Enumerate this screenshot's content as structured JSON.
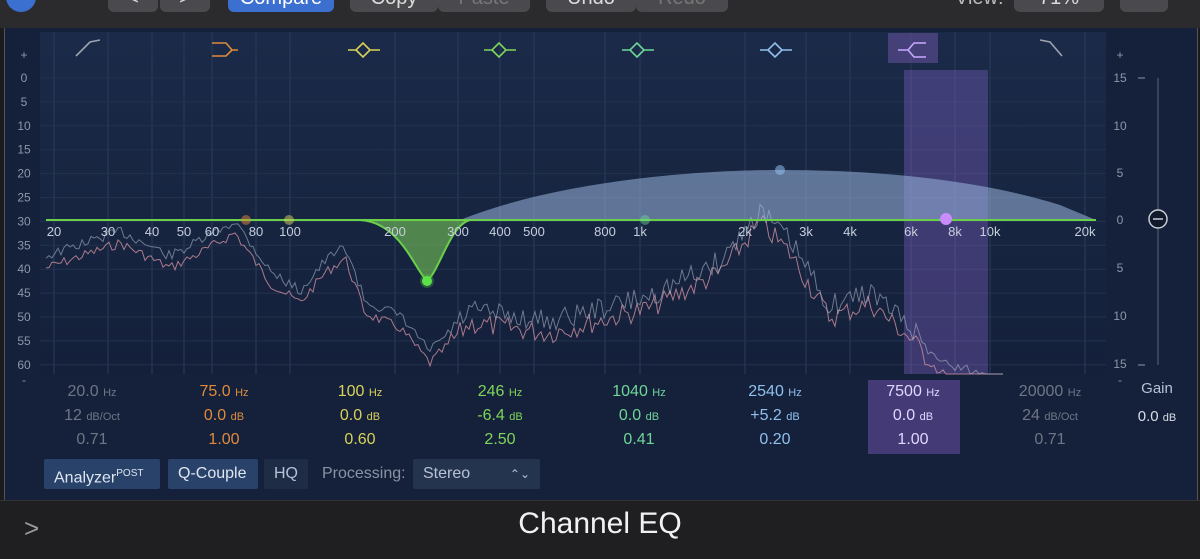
{
  "toolbar": {
    "back_label": "<",
    "forward_label": ">",
    "compare_label": "Compare",
    "copy_label": "Copy",
    "paste_label": "Paste",
    "undo_label": "Undo",
    "redo_label": "Redo",
    "view_label": "View:",
    "view_value": "71%"
  },
  "colors": {
    "band1": "#9ea3ad",
    "band2": "#e08a3c",
    "band3": "#d9d25a",
    "band4": "#7fd65a",
    "band5": "#6fd69a",
    "band6": "#8fc0ee",
    "band7": "#c8a8ff",
    "band8": "#9ea3ad",
    "curve": "#6ad04a",
    "fill": "#9ab6de"
  },
  "left_scale": [
    "+",
    "0",
    "5",
    "10",
    "15",
    "20",
    "25",
    "30",
    "35",
    "40",
    "45",
    "50",
    "55",
    "60",
    "-"
  ],
  "right_scale": [
    "+",
    "15",
    "10",
    "5",
    "0",
    "5",
    "10",
    "15",
    "-"
  ],
  "freq_labels": [
    "20",
    "30",
    "40",
    "50",
    "60",
    "80",
    "100",
    "200",
    "300",
    "400",
    "500",
    "800",
    "1k",
    "2k",
    "3k",
    "4k",
    "6k",
    "8k",
    "10k",
    "20k"
  ],
  "bands": [
    {
      "freq": "20.0",
      "freq_unit": "Hz",
      "gain": "12",
      "gain_unit": "dB/Oct",
      "q": "0.71",
      "icon": "low-cut-icon"
    },
    {
      "freq": "75.0",
      "freq_unit": "Hz",
      "gain": "0.0",
      "gain_unit": "dB",
      "q": "1.00",
      "icon": "low-shelf-icon"
    },
    {
      "freq": "100",
      "freq_unit": "Hz",
      "gain": "0.0",
      "gain_unit": "dB",
      "q": "0.60",
      "icon": "bell-icon"
    },
    {
      "freq": "246",
      "freq_unit": "Hz",
      "gain": "-6.4",
      "gain_unit": "dB",
      "q": "2.50",
      "icon": "bell-icon"
    },
    {
      "freq": "1040",
      "freq_unit": "Hz",
      "gain": "0.0",
      "gain_unit": "dB",
      "q": "0.41",
      "icon": "bell-icon"
    },
    {
      "freq": "2540",
      "freq_unit": "Hz",
      "gain": "+5.2",
      "gain_unit": "dB",
      "q": "0.20",
      "icon": "bell-icon"
    },
    {
      "freq": "7500",
      "freq_unit": "Hz",
      "gain": "0.0",
      "gain_unit": "dB",
      "q": "1.00",
      "icon": "high-shelf-icon"
    },
    {
      "freq": "20000",
      "freq_unit": "Hz",
      "gain": "24",
      "gain_unit": "dB/Oct",
      "q": "0.71",
      "icon": "high-cut-icon"
    }
  ],
  "controls": {
    "analyzer_label": "Analyzer",
    "analyzer_sup": "POST",
    "qcouple_label": "Q-Couple",
    "hq_label": "HQ",
    "processing_label": "Processing:",
    "processing_value": "Stereo"
  },
  "gain": {
    "label": "Gain",
    "value": "0.0",
    "unit": "dB"
  },
  "footer": {
    "title": "Channel EQ",
    "expand_icon": ">"
  }
}
